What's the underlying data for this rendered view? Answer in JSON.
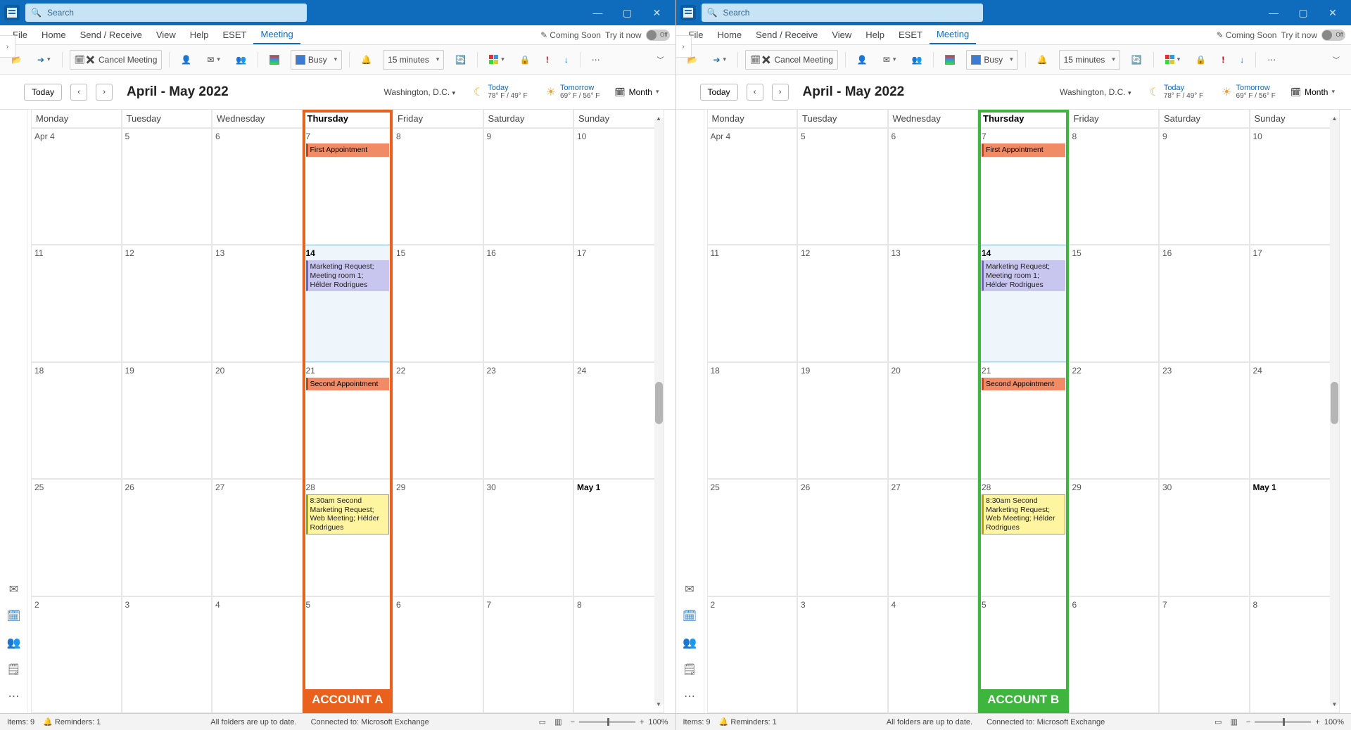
{
  "panes": [
    {
      "account_label": "ACCOUNT A",
      "hl_color": "#e8621d"
    },
    {
      "account_label": "ACCOUNT B",
      "hl_color": "#3eb63e"
    }
  ],
  "search_placeholder": "Search",
  "window_controls": {
    "min": "—",
    "max": "▢",
    "close": "✕"
  },
  "menu": {
    "tabs": [
      "File",
      "Home",
      "Send / Receive",
      "View",
      "Help",
      "ESET",
      "Meeting"
    ],
    "active": "Meeting"
  },
  "coming_soon": "Coming Soon",
  "try_it": "Try it now",
  "toggle_off": "Off",
  "toolbar": {
    "cancel_meeting": "Cancel Meeting",
    "busy": "Busy",
    "reminder": "15 minutes"
  },
  "subhead": {
    "today": "Today",
    "range": "April - May 2022",
    "location": "Washington, D.C.",
    "month_label": "Month",
    "weather_today_label": "Today",
    "weather_today_temp": "78° F / 49° F",
    "weather_tomorrow_label": "Tomorrow",
    "weather_tomorrow_temp": "69° F / 56° F"
  },
  "days": [
    "Monday",
    "Tuesday",
    "Wednesday",
    "Thursday",
    "Friday",
    "Saturday",
    "Sunday"
  ],
  "grid": {
    "rows": [
      [
        "Apr 4",
        "5",
        "6",
        "7",
        "8",
        "9",
        "10"
      ],
      [
        "11",
        "12",
        "13",
        "14",
        "15",
        "16",
        "17"
      ],
      [
        "18",
        "19",
        "20",
        "21",
        "22",
        "23",
        "24"
      ],
      [
        "25",
        "26",
        "27",
        "28",
        "29",
        "30",
        "May 1"
      ],
      [
        "2",
        "3",
        "4",
        "5",
        "6",
        "7",
        "8"
      ]
    ],
    "today_cell": "14",
    "bold_cells": [
      "14",
      "May 1"
    ]
  },
  "events": {
    "7": [
      {
        "text": "First Appointment",
        "cls": "orange"
      }
    ],
    "14": [
      {
        "text": "Marketing Request; Meeting room 1; Hélder Rodrigues",
        "cls": "purple"
      }
    ],
    "21": [
      {
        "text": "Second Appointment",
        "cls": "orange"
      }
    ],
    "28": [
      {
        "text": "8:30am Second Marketing Request; Web Meeting; Hélder Rodrigues",
        "cls": "yellow"
      }
    ]
  },
  "status": {
    "items": "Items: 9",
    "reminders": "Reminders: 1",
    "folders": "All folders are up to date.",
    "connected": "Connected to: Microsoft Exchange",
    "zoom": "100%"
  }
}
